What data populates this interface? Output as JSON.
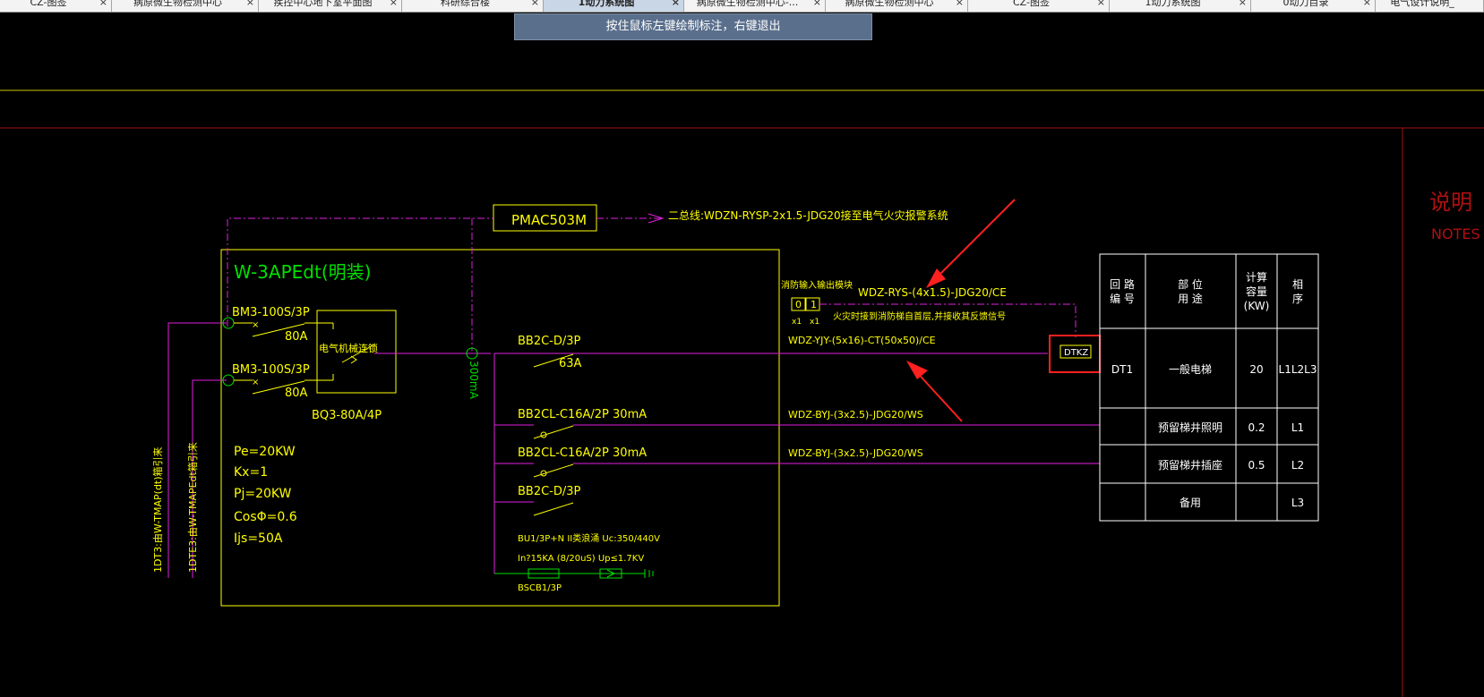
{
  "tabs": [
    {
      "label": "CZ-图签"
    },
    {
      "label": "病原微生物检测中心"
    },
    {
      "label": "疾控中心地下室平面图"
    },
    {
      "label": "科研综合楼"
    },
    {
      "label": "1动力系统图"
    },
    {
      "label": "病原微生物检测中心-..."
    },
    {
      "label": "病原微生物检测中心"
    },
    {
      "label": "CZ-图签"
    },
    {
      "label": "1动力系统图"
    },
    {
      "label": "0动力目录"
    },
    {
      "label": "电气设计说明_"
    }
  ],
  "active_tab": 4,
  "tab_close_glyph": "×",
  "hint": "按住鼠标左键绘制标注，右键退出",
  "drawing": {
    "pmac_label": "PMAC503M",
    "bus_label": "二总线:WDZN-RYSP-2x1.5-JDG20接至电气火灾报警系统",
    "panel_title": "W-3APEdt(明装)",
    "breaker1": "BM3-100S/3P",
    "breaker1_rating": "80A",
    "breaker2": "BM3-100S/3P",
    "breaker2_rating": "80A",
    "interlock": "电气机械连锁",
    "ats_label": "BQ3-80A/4P",
    "ct_label": "300mA",
    "bb2c": "BB2C-D/3P",
    "bb2c_rating": "63A",
    "bb2cl_1": "BB2CL-C16A/2P 30mA",
    "bb2cl_2": "BB2CL-C16A/2P 30mA",
    "bb2c_spare": "BB2C-D/3P",
    "spd1": "BU1/3P+N II类浪涌 Uc:350/440V",
    "spd2": "In?15KA (8/20uS) Up≤1.7KV",
    "spd3": "BSCB1/3P",
    "params": [
      "Pe=20KW",
      "Kx=1",
      "Pj=20KW",
      "CosΦ=0.6",
      "Ijs=50A"
    ],
    "feeder1": "1DT3:由W-TMAP(dt)箱引来",
    "feeder2": "1DTE3:由W-TMAPEdt箱引来",
    "fire_module": "消防输入输出模块",
    "module_box1": "0",
    "module_box2": "1",
    "module_x1": "x1",
    "module_x2": "x1",
    "rys_cable": "WDZ-RYS-(4x1.5)-JDG20/CE",
    "fire_note": "火灾时接到消防梯自首层,并接收其反馈信号",
    "main_cable": "WDZ-YJY-(5x16)-CT(50x50)/CE",
    "dtkz": "DTKZ",
    "branch_cable1": "WDZ-BYJ-(3x2.5)-JDG20/WS",
    "branch_cable2": "WDZ-BYJ-(3x2.5)-JDG20/WS",
    "table": {
      "h1": "回 路\n编 号",
      "h2": "部 位\n用 途",
      "h3": "计算\n容量\n(KW)",
      "h4": "相\n序",
      "rows": [
        {
          "c1": "DT1",
          "c2": "一般电梯",
          "c3": "20",
          "c4": "L1L2L3"
        },
        {
          "c1": "",
          "c2": "预留梯井照明",
          "c3": "0.2",
          "c4": "L1"
        },
        {
          "c1": "",
          "c2": "预留梯井插座",
          "c3": "0.5",
          "c4": "L2"
        },
        {
          "c1": "",
          "c2": "备用",
          "c3": "",
          "c4": "L3"
        }
      ]
    },
    "notes_cn": "说明",
    "notes_en": "NOTES"
  },
  "colors": {
    "yellow": "#ffff00",
    "magenta": "#e020e0",
    "green": "#00e000",
    "red": "#ff2020",
    "darkred": "#b01010",
    "white": "#ffffff"
  }
}
